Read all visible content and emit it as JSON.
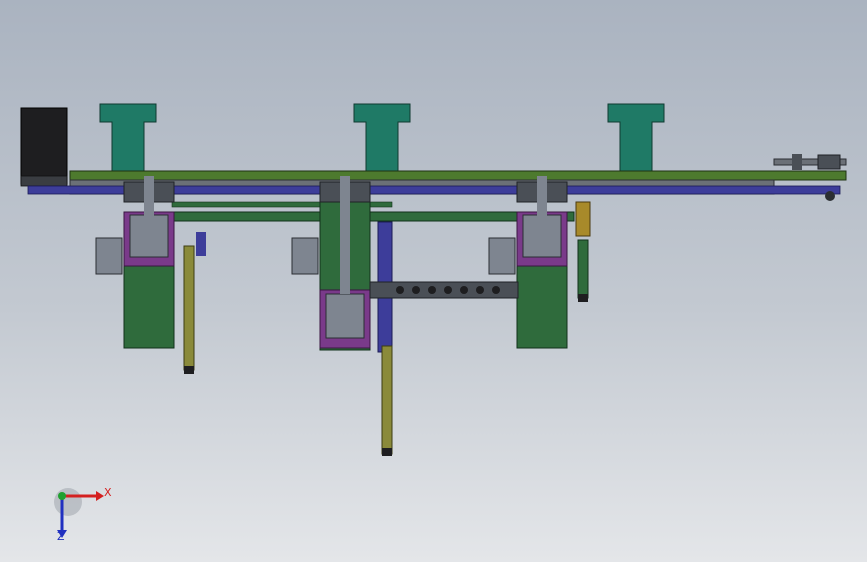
{
  "colors": {
    "background_top": "#aab3c0",
    "background_bottom": "#e4e6e9",
    "frame_green": "#4d7a2e",
    "bracket_teal": "#1f7a66",
    "module_green": "#2f6b3c",
    "module_purple": "#7a3a8a",
    "steel_gray": "#7e8590",
    "dark_gray": "#4a4f56",
    "rod_olive": "#8a8a3a",
    "blue_part": "#3d3d9a",
    "motor_black": "#1e1e20",
    "orange_part": "#a88a2a",
    "axis_x": "#d42020",
    "axis_y": "#20a030",
    "axis_z": "#2030c0"
  },
  "view": {
    "triad": {
      "x_label": "X",
      "z_label": "Z"
    }
  }
}
